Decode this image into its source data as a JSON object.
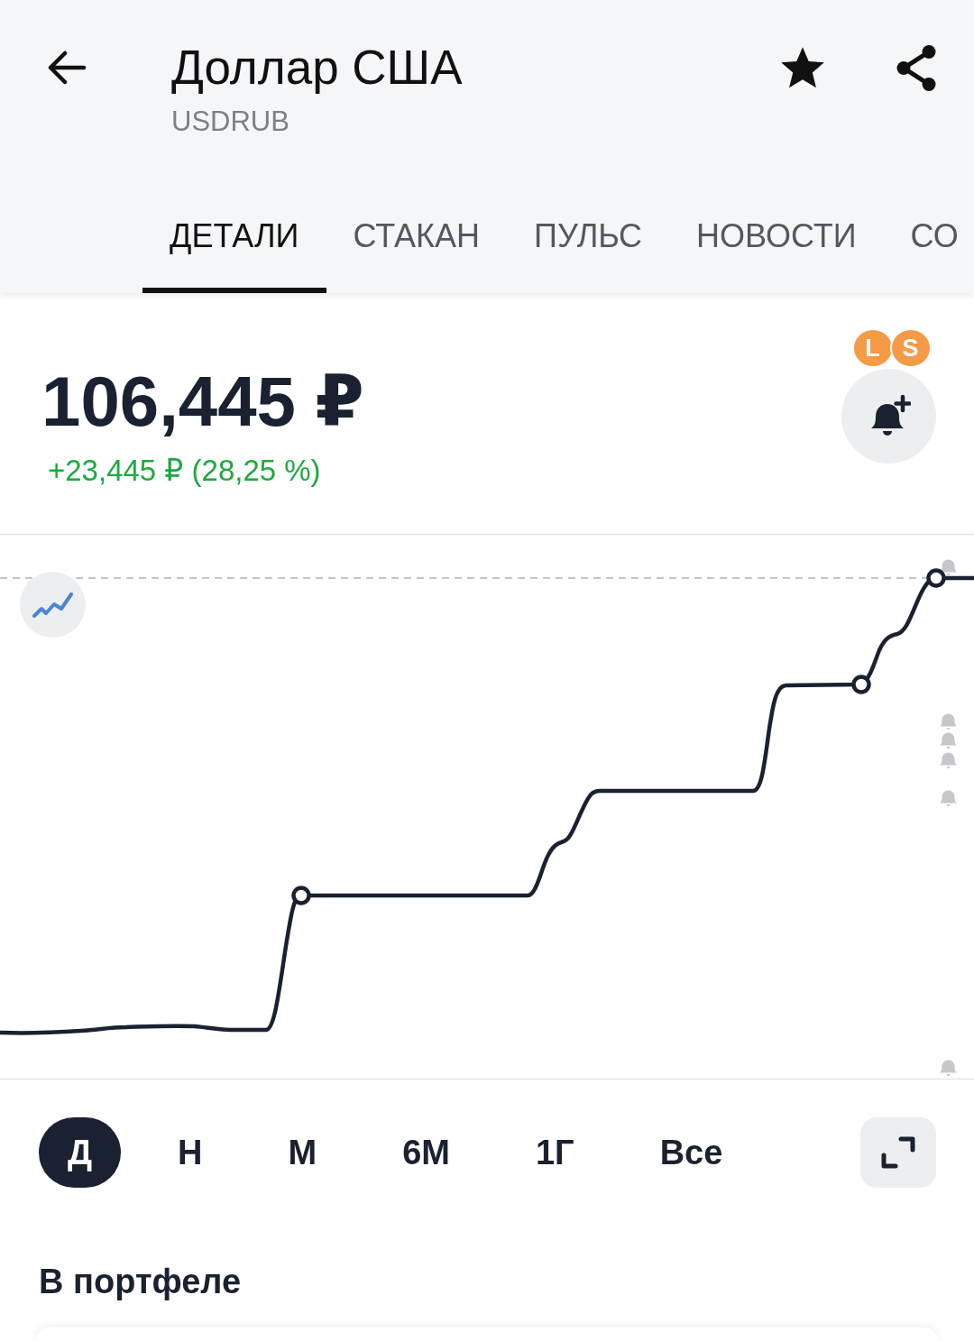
{
  "header": {
    "title": "Доллар США",
    "ticker": "USDRUB",
    "favorite": true
  },
  "tabs": [
    {
      "label": "ДЕТАЛИ",
      "selected": true
    },
    {
      "label": "СТАКАН",
      "selected": false
    },
    {
      "label": "ПУЛЬС",
      "selected": false
    },
    {
      "label": "НОВОСТИ",
      "selected": false
    },
    {
      "label": "СО",
      "selected": false
    }
  ],
  "quote": {
    "price": "106,445 ₽",
    "change": "+23,445 ₽ (28,25 %)",
    "positive": true,
    "badges": [
      "L",
      "S"
    ]
  },
  "periods": [
    {
      "label": "Д",
      "selected": true
    },
    {
      "label": "Н",
      "selected": false
    },
    {
      "label": "М",
      "selected": false
    },
    {
      "label": "6М",
      "selected": false
    },
    {
      "label": "1Г",
      "selected": false
    },
    {
      "label": "Все",
      "selected": false
    }
  ],
  "portfolio": {
    "title": "В портфеле"
  }
}
